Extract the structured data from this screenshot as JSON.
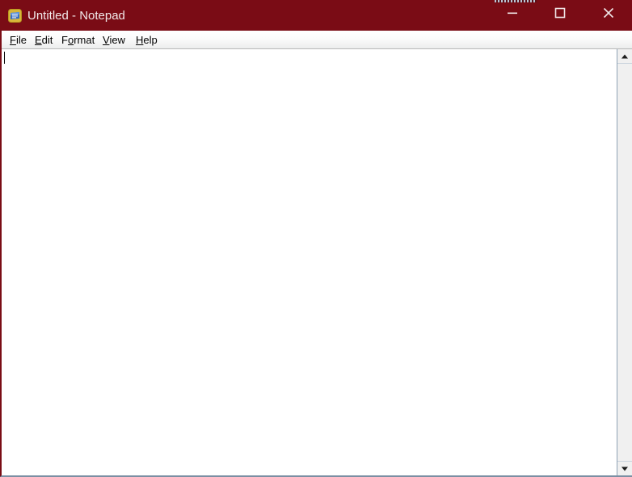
{
  "window": {
    "title": "Untitled - Notepad",
    "app_name": "Notepad",
    "document_name": "Untitled",
    "icon": "notepad-app-icon",
    "titlebar_color": "#7a0c15",
    "titlebar_text_color": "#f2e9ea",
    "border_left_color": "#7a0c15",
    "border_bottom_color": "#7b8fa3"
  },
  "window_controls": {
    "minimize": {
      "label": "Minimize",
      "icon": "minimize-icon"
    },
    "maximize": {
      "label": "Maximize",
      "icon": "maximize-icon"
    },
    "close": {
      "label": "Close",
      "icon": "close-icon"
    }
  },
  "menubar": {
    "items": [
      {
        "label": "File",
        "accesskey": "F",
        "pre": "",
        "key": "F",
        "post": "ile"
      },
      {
        "label": "Edit",
        "accesskey": "E",
        "pre": "",
        "key": "E",
        "post": "dit"
      },
      {
        "label": "Format",
        "accesskey": "o",
        "pre": "F",
        "key": "o",
        "post": "rmat"
      },
      {
        "label": "View",
        "accesskey": "V",
        "pre": "",
        "key": "V",
        "post": "iew"
      },
      {
        "label": "Help",
        "accesskey": "H",
        "pre": "",
        "key": "H",
        "post": "elp"
      }
    ]
  },
  "editor": {
    "content": "",
    "placeholder": "",
    "caret_visible": true,
    "background_color": "#ffffff",
    "text_color": "#000000"
  },
  "scrollbar": {
    "orientation": "vertical",
    "up_arrow": "scroll-up-arrow-icon",
    "down_arrow": "scroll-down-arrow-icon",
    "thumb_visible": false,
    "track_color": "#f0f0f0"
  }
}
